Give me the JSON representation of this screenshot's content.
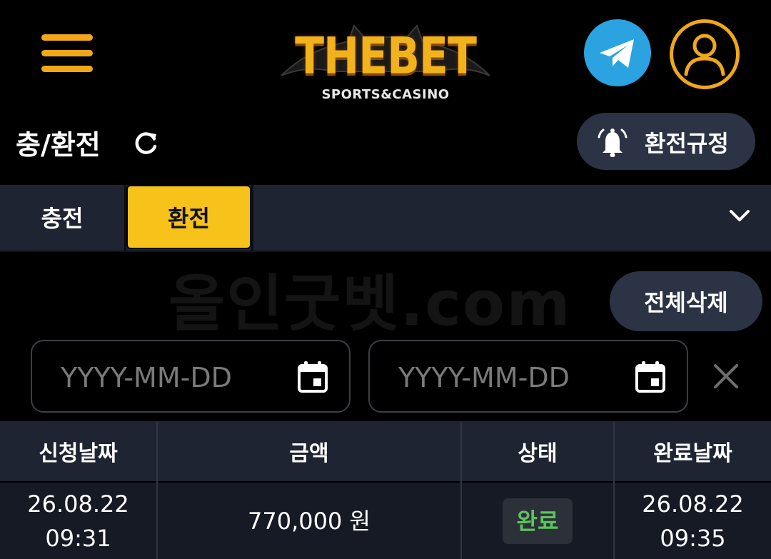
{
  "header": {
    "logo_title": "THEBET",
    "logo_subtitle": "SPORTS&CASINO",
    "menu_icon": "hamburger-menu-icon",
    "telegram_icon": "telegram-icon",
    "user_icon": "user-icon"
  },
  "page": {
    "title": "충/환전",
    "rules_button_label": "환전규정"
  },
  "tabs": [
    {
      "label": "충전",
      "active": false
    },
    {
      "label": "환전",
      "active": true
    }
  ],
  "watermark": "올인굿벳.com",
  "actions": {
    "delete_all_label": "전체삭제"
  },
  "filters": {
    "start_date_placeholder": "YYYY-MM-DD",
    "end_date_placeholder": "YYYY-MM-DD"
  },
  "table": {
    "headers": [
      "신청날짜",
      "금액",
      "상태",
      "완료날짜"
    ],
    "rows": [
      {
        "request_date": "26.08.22",
        "request_time": "09:31",
        "amount": "770,000 원",
        "status": "완료",
        "complete_date": "26.08.22",
        "complete_time": "09:35"
      }
    ]
  },
  "colors": {
    "accent": "#f7c21a",
    "menu": "#f0a818",
    "telegram": "#2aa3e0",
    "panel": "#1e2431",
    "pill": "#2b3344",
    "status_complete": "#5cc35c"
  }
}
